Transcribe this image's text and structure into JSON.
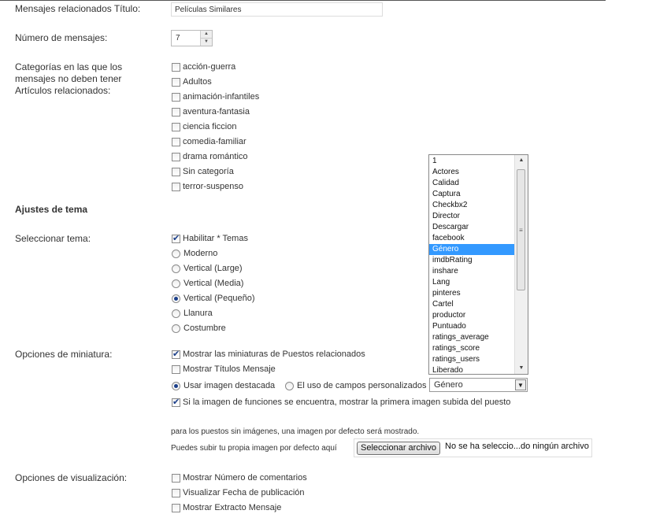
{
  "fields": {
    "related_title_label": "Mensajes relacionados Título:",
    "related_title_value": "Películas Similares",
    "num_posts_label": "Número de mensajes:",
    "num_posts_value": "7",
    "categories_label_1": "Categorías en las que los",
    "categories_label_2": "mensajes no deben tener",
    "categories_label_3": "Artículos relacionados:"
  },
  "categories": [
    "acción-guerra",
    "Adultos",
    "animación-infantiles",
    "aventura-fantasia",
    "ciencia ficcion",
    "comedia-familiar",
    "drama romántico",
    "Sin categoría",
    "terror-suspenso"
  ],
  "theme": {
    "heading": "Ajustes de tema",
    "select_label": "Seleccionar tema:",
    "enable_label": "Habilitar * Temas",
    "options": [
      "Moderno",
      "Vertical (Large)",
      "Vertical (Media)",
      "Vertical (Pequeño)",
      "Llanura",
      "Costumbre"
    ],
    "selected": "Vertical (Pequeño)"
  },
  "thumbnail": {
    "label": "Opciones de miniatura:",
    "show_thumbs": "Mostrar las miniaturas de Puestos relacionados",
    "show_titles": "Mostrar Títulos Mensaje",
    "use_featured": "Usar imagen destacada",
    "use_custom": "El uso de campos personalizados",
    "custom_field_value": "Género",
    "first_image": "Si la imagen de funciones se encuentra, mostrar la primera imagen subida del puesto",
    "default_note": "para los puestos sin imágenes, una imagen por defecto será mostrado.",
    "upload_note": "Puedes subir tu propia imagen por defecto aquí",
    "file_button": "Seleccionar archivo",
    "file_status": "No se ha seleccio...do ningún archivo"
  },
  "listbox": {
    "items": [
      "1",
      "Actores",
      "Calidad",
      "Captura",
      "Checkbx2",
      "Director",
      "Descargar",
      "facebook",
      "Género",
      "imdbRating",
      "inshare",
      "Lang",
      "pinteres",
      "Cartel",
      "productor",
      "Puntuado",
      "ratings_average",
      "ratings_score",
      "ratings_users",
      "Liberado"
    ],
    "selected": "Género"
  },
  "display": {
    "label": "Opciones de visualización:",
    "options": [
      "Mostrar Número de comentarios",
      "Visualizar Fecha de publicación",
      "Mostrar Extracto Mensaje"
    ]
  }
}
